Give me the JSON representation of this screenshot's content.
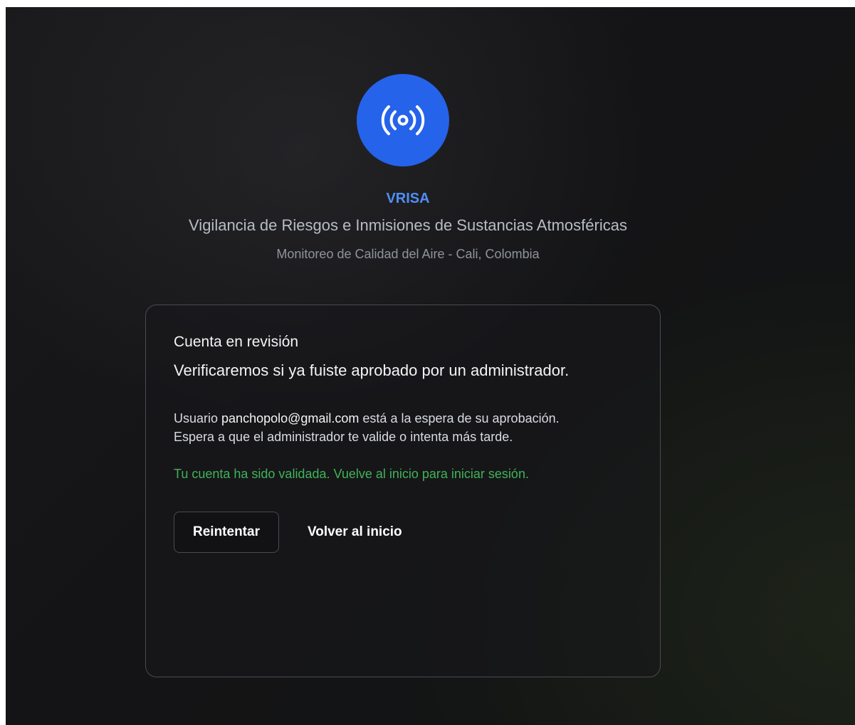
{
  "logo": {
    "icon": "broadcast-icon",
    "bg_color": "#2563eb"
  },
  "brand": {
    "name": "VRISA",
    "full_name": "Vigilancia de Riesgos e Inmisiones de Sustancias Atmosféricas",
    "subtitle": "Monitoreo de Calidad del Aire - Cali, Colombia",
    "name_color": "#4f8ff7"
  },
  "card": {
    "title": "Cuenta en revisión",
    "headline": "Verificaremos si ya fuiste aprobado por un administrador.",
    "message_prefix": "Usuario ",
    "user_email": "panchopolo@gmail.com",
    "message_suffix": " está a la espera de su aprobación.",
    "message_line2": "Espera a que el administrador te valide o intenta más tarde.",
    "success_message": "Tu cuenta ha sido validada. Vuelve al inicio para iniciar sesión.",
    "success_color": "#3fb35a"
  },
  "actions": {
    "retry_label": "Reintentar",
    "home_label": "Volver al inicio"
  }
}
